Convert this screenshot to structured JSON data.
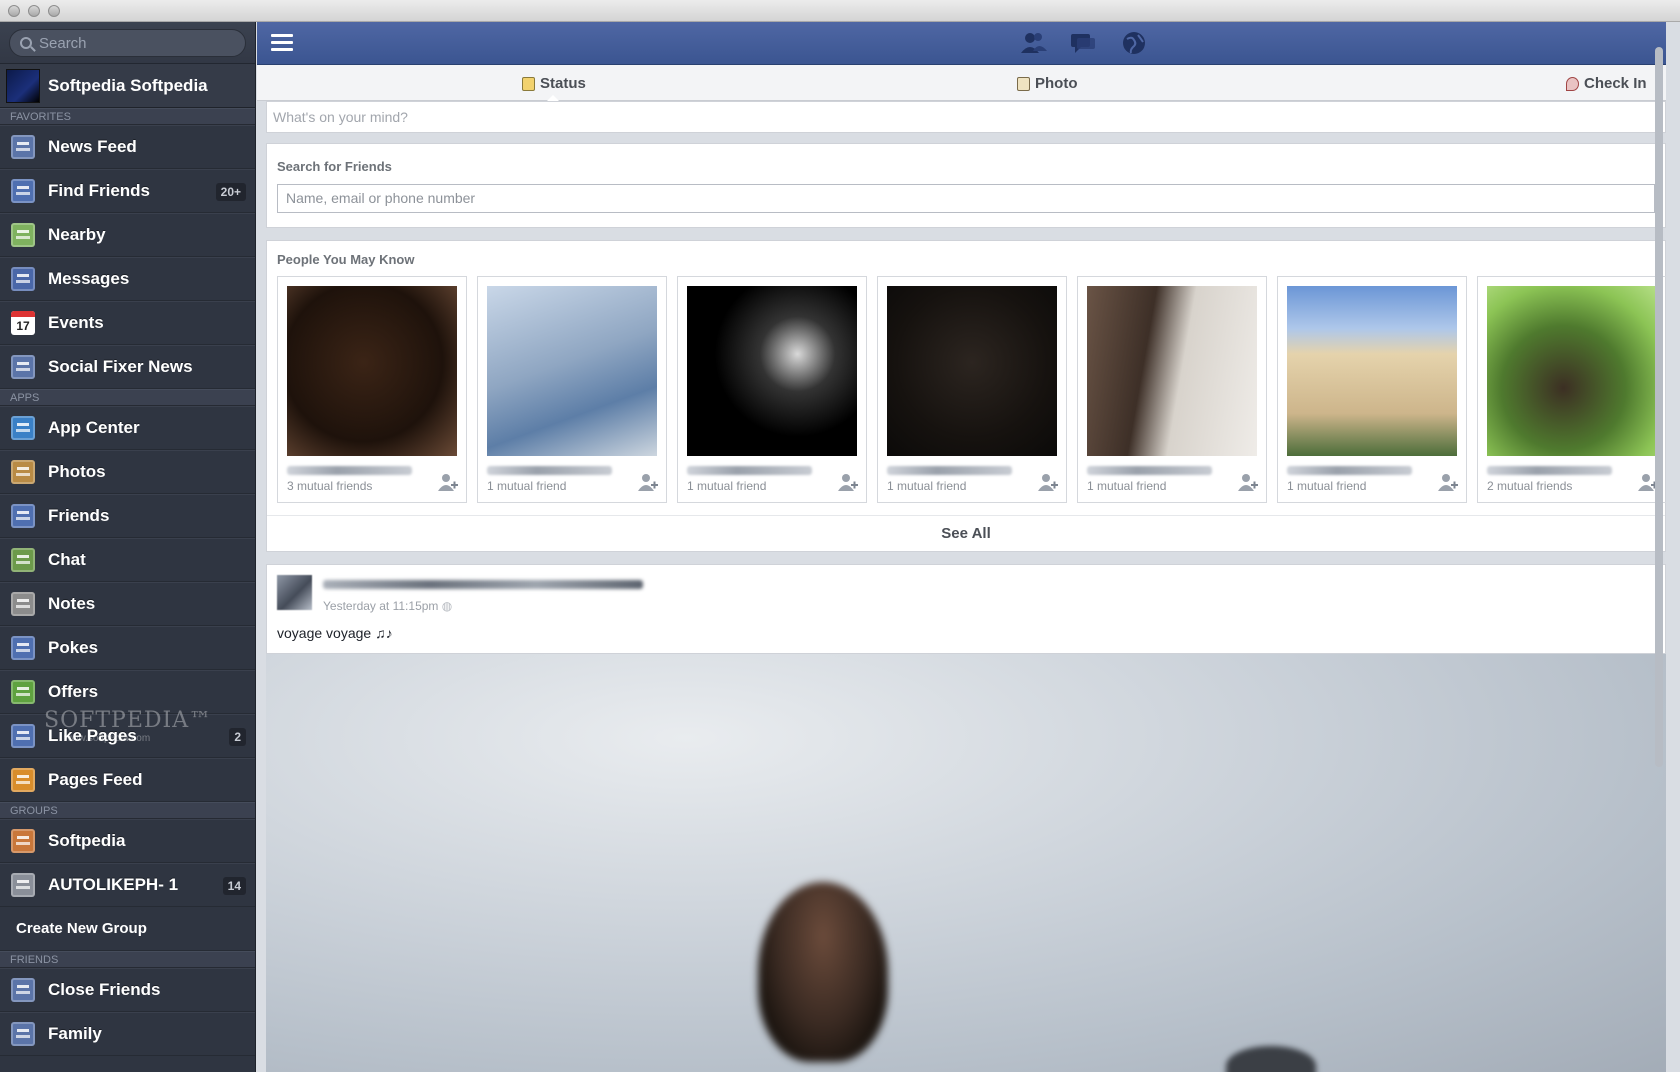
{
  "sidebar": {
    "search_placeholder": "Search",
    "profile_name": "Softpedia Softpedia",
    "headers": {
      "favorites": "FAVORITES",
      "apps": "APPS",
      "groups": "GROUPS",
      "friends": "FRIENDS"
    },
    "favorites": [
      {
        "label": "News Feed",
        "icon": "news-feed-icon",
        "color": "#5b74a8"
      },
      {
        "label": "Find Friends",
        "icon": "find-friends-icon",
        "color": "#4f6fb0",
        "badge": "20+"
      },
      {
        "label": "Nearby",
        "icon": "map-pin-icon",
        "color": "#7fb25f"
      },
      {
        "label": "Messages",
        "icon": "messages-icon",
        "color": "#4a67a8"
      },
      {
        "label": "Events",
        "icon": "calendar-icon",
        "color": "#ffffff",
        "badge_text": "17"
      },
      {
        "label": "Social Fixer News",
        "icon": "newspaper-icon",
        "color": "#5b74a8"
      }
    ],
    "apps": [
      {
        "label": "App Center",
        "icon": "app-center-icon",
        "color": "#3a80c6"
      },
      {
        "label": "Photos",
        "icon": "photos-icon",
        "color": "#b98b45"
      },
      {
        "label": "Friends",
        "icon": "friends-icon",
        "color": "#4f6fb0"
      },
      {
        "label": "Chat",
        "icon": "chat-icon",
        "color": "#6c9a4a"
      },
      {
        "label": "Notes",
        "icon": "notes-icon",
        "color": "#8c8c8c"
      },
      {
        "label": "Pokes",
        "icon": "poke-icon",
        "color": "#4f6fb0"
      },
      {
        "label": "Offers",
        "icon": "offers-icon",
        "color": "#5fa23f"
      },
      {
        "label": "Like Pages",
        "icon": "thumbs-up-icon",
        "color": "#4f6fb0",
        "badge": "2"
      },
      {
        "label": "Pages Feed",
        "icon": "pages-feed-icon",
        "color": "#d98d2b"
      }
    ],
    "groups": [
      {
        "label": "Softpedia",
        "icon": "group-paw-icon",
        "color": "#c9773a"
      },
      {
        "label": "AUTOLIKEPH- 1",
        "icon": "group-hand-icon",
        "color": "#8a8f99",
        "badge": "14"
      }
    ],
    "create_group": "Create New Group",
    "friends": [
      {
        "label": "Close Friends",
        "icon": "list-icon",
        "color": "#5b74a8"
      },
      {
        "label": "Family",
        "icon": "list-icon",
        "color": "#5b74a8"
      }
    ],
    "watermark": "SOFTPEDIA™",
    "watermark_url": "www.softpedia.com"
  },
  "topbar": {
    "icons": [
      "friend-requests-icon",
      "messages-icon",
      "notifications-globe-icon"
    ]
  },
  "composer": {
    "tabs": {
      "status": "Status",
      "photo": "Photo",
      "checkin": "Check In"
    },
    "placeholder": "What's on your mind?"
  },
  "search_friends": {
    "title": "Search for Friends",
    "placeholder": "Name, email or phone number"
  },
  "pymk": {
    "title": "People You May Know",
    "see_all": "See All",
    "people": [
      {
        "mutual": "3 mutual friends",
        "photo_bg": "radial-gradient(ellipse at 45% 45%, #3b2416, #1e120b 60%, #6a4a36)"
      },
      {
        "mutual": "1 mutual friend",
        "photo_bg": "linear-gradient(160deg, #c9d7e8, #8fa6c2 45%, #5d7ea7 70%, #cdd6df)"
      },
      {
        "mutual": "1 mutual friend",
        "photo_bg": "radial-gradient(circle at 65% 40%, #d9d9d9, #333 25%, #000 55%)"
      },
      {
        "mutual": "1 mutual friend",
        "photo_bg": "radial-gradient(circle at 50% 45%, #2c2520, #16120f 60%, #0b0a09)"
      },
      {
        "mutual": "1 mutual friend",
        "photo_bg": "linear-gradient(100deg, #6a5446, #3d2f27 35%, #d8d3cc 55%, #efece8)"
      },
      {
        "mutual": "1 mutual friend",
        "photo_bg": "linear-gradient(180deg, #6b96d6 0%, #aec7ea 25%, #e5d3ac 40%, #cdb58b 75%, #4c6d3a 100%)"
      },
      {
        "mutual": "2 mutual friends",
        "photo_bg": "radial-gradient(circle at 45% 60%, #3c2f23, #4f7a2e 45%, #8cc455 75%, #b6df87)"
      }
    ]
  },
  "post": {
    "time": "Yesterday at 11:15pm",
    "text": "voyage voyage ♫♪"
  }
}
